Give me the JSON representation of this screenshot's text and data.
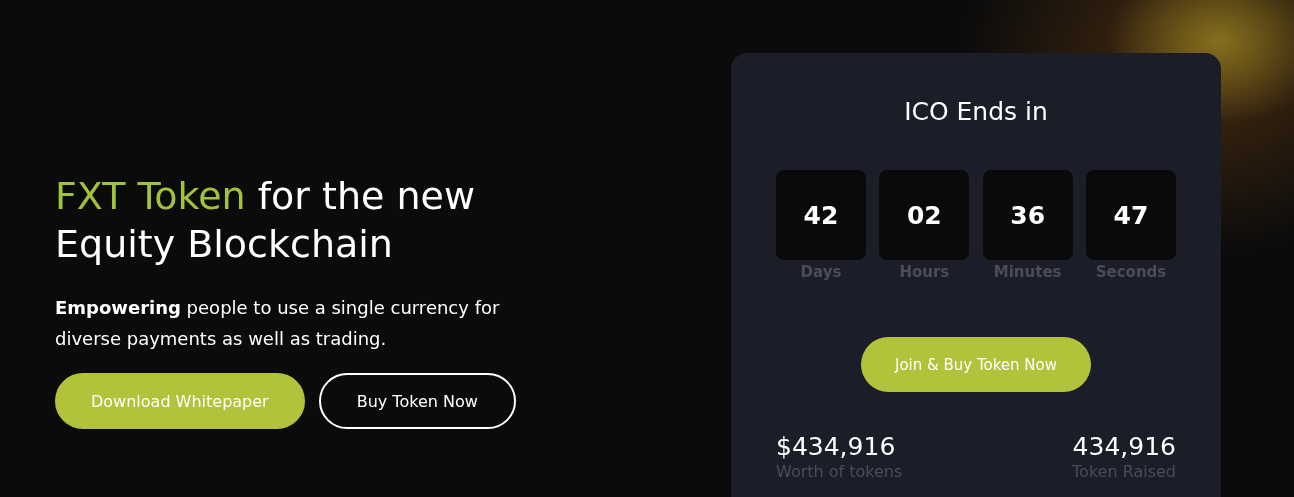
{
  "hero": {
    "title_highlight": "FXT Token",
    "title_rest": "for the new Equity Blockchain",
    "description": "**Empowering** people to use a single currency for diverse payments as well as trading.",
    "buttons": [
      {
        "label": "Download Whitepaper",
        "kind": "filled"
      },
      {
        "label": "Buy Token Now",
        "kind": "outline"
      }
    ]
  },
  "ico_card": {
    "title": "ICO Ends in",
    "countdown": [
      {
        "value": "42",
        "unit": "Days"
      },
      {
        "value": "02",
        "unit": "Hours"
      },
      {
        "value": "36",
        "unit": "Minutes"
      },
      {
        "value": "47",
        "unit": "Seconds"
      }
    ],
    "button": "Join & Buy Token Now",
    "stats": [
      {
        "value": "$434,916",
        "label": "Worth of tokens"
      },
      {
        "value": "434,916",
        "label": "Token Raised"
      }
    ]
  }
}
